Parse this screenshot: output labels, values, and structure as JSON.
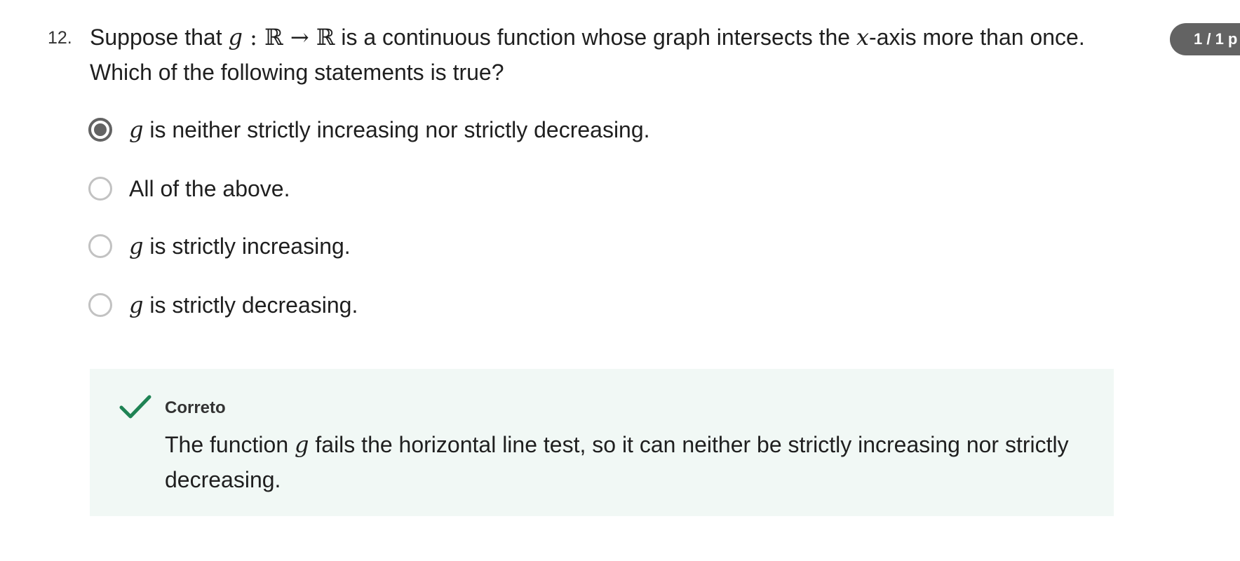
{
  "question": {
    "number": "12.",
    "text_1": "Suppose that ",
    "math_g": "g",
    "math_map": " : ℝ → ℝ",
    "text_2": " is a continuous function whose graph intersects the ",
    "math_x": "x",
    "text_3": "-axis more than once. Which of the following statements is true?"
  },
  "points_badge": "1 / 1 p",
  "options": [
    {
      "math": "g",
      "text": " is neither strictly increasing nor strictly decreasing.",
      "selected": true
    },
    {
      "math": "",
      "text": "All of the above.",
      "selected": false
    },
    {
      "math": "g",
      "text": " is strictly increasing.",
      "selected": false
    },
    {
      "math": "g",
      "text": " is strictly decreasing.",
      "selected": false
    }
  ],
  "feedback": {
    "title": "Correto",
    "text_1": "The function ",
    "math_g": "g",
    "text_2": " fails the horizontal line test, so it can neither be strictly increasing nor strictly decreasing.",
    "icon": "checkmark-icon",
    "icon_color": "#1f8354",
    "background": "#f1f8f5"
  },
  "colors": {
    "badge": "#636363",
    "radio_selected": "#636363",
    "radio_unselected": "#c2c2c2"
  }
}
